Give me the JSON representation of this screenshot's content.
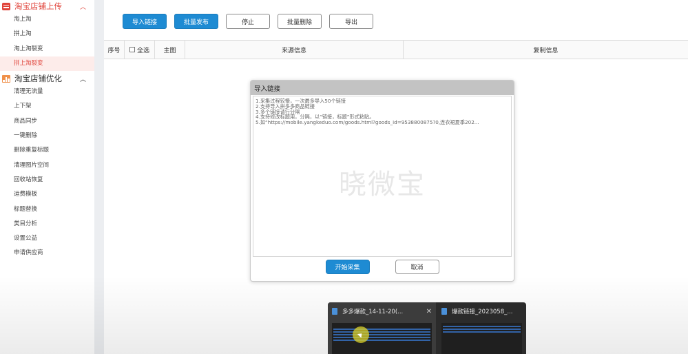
{
  "sidebar": {
    "section1": {
      "title": "淘宝店铺上传",
      "items": [
        "淘上淘",
        "拼上淘",
        "淘上淘裂变",
        "拼上淘裂变"
      ],
      "active_index": 3
    },
    "section2": {
      "title": "淘宝店铺优化",
      "items": [
        "清理无流量",
        "上下架",
        "商品同步",
        "一键删除",
        "删除重复标题",
        "清理图片空间",
        "回收站恢复",
        "运费模板",
        "标题替换",
        "类目分析",
        "设置公益",
        "申请供应商"
      ]
    }
  },
  "toolbar": {
    "import_label": "导入链接",
    "publish_label": "批量发布",
    "stop_label": "停止",
    "batch_delete_label": "批量删除",
    "export_label": "导出"
  },
  "table": {
    "col_index": "序号",
    "col_select_all": "全选",
    "col_main_image": "主图",
    "col_source": "来源信息",
    "col_copy": "复制信息"
  },
  "modal": {
    "title": "导入链接",
    "hints": [
      "1.采集过程较慢，一次最多导入50个链接",
      "2.支持导入拼多多商品链接",
      "3.多个链接请行分隔",
      "4.支持修改标题用，分隔，以“链接，标题”形式粘贴。",
      "5.如“https://mobile.yangkeduo.com/goods.html?goods_id=9538800875?0,连衣裙夏季202..."
    ],
    "watermark": "晓微宝",
    "confirm_label": "开始采集",
    "cancel_label": "取消"
  },
  "taskbar_preview": {
    "window1_title": "多多爆款_14-11-20(...",
    "window2_title": "爆款链接_2023058_..."
  },
  "colors": {
    "accent_red": "#e0433a",
    "primary_blue": "#1e8bd3"
  }
}
